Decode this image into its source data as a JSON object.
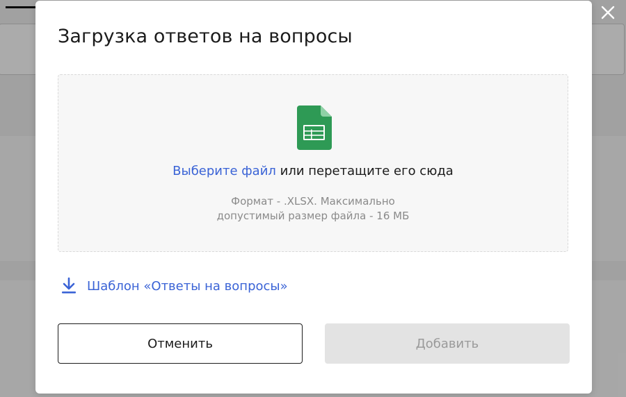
{
  "modal": {
    "title": "Загрузка ответов на вопросы",
    "dropzone": {
      "pick_link": "Выберите файл",
      "drop_text": " или перетащите его сюда",
      "hint_line1": "Формат - .XLSX. Максимально",
      "hint_line2": "допустимый размер файла - 16 МБ",
      "file_icon": "spreadsheet-icon"
    },
    "template_link": {
      "label": "Шаблон «Ответы на вопросы»",
      "icon": "download-icon"
    },
    "buttons": {
      "cancel": "Отменить",
      "add": "Добавить",
      "add_disabled": true
    }
  },
  "colors": {
    "link": "#3a63d6",
    "sheet_green": "#2e9a55",
    "disabled_bg": "#e3e3e3",
    "overlay": "rgba(0,0,0,0.33)"
  }
}
